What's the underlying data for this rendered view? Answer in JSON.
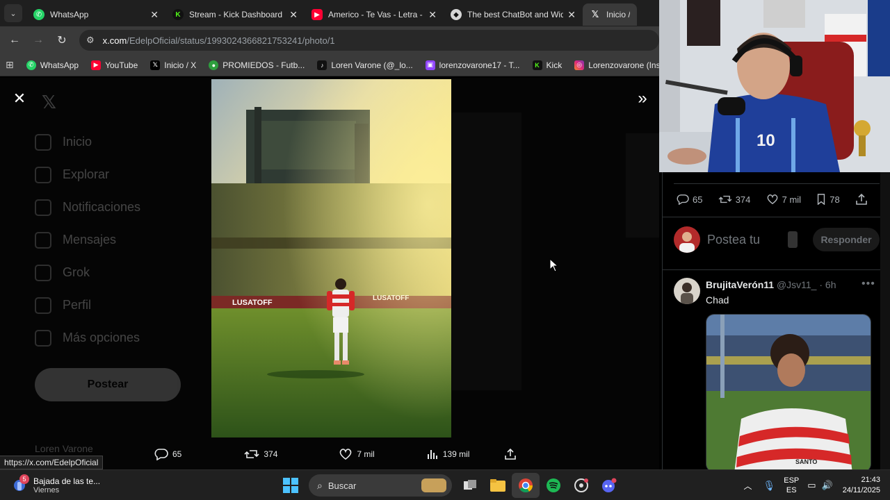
{
  "browser": {
    "tabs": [
      {
        "title": "WhatsApp",
        "icon": "whatsapp-icon",
        "color": "#25d366"
      },
      {
        "title": "Stream - Kick Dashboard",
        "icon": "kick-icon",
        "color": "#53fc18"
      },
      {
        "title": "Americo - Te Vas - Letra - Yo",
        "icon": "youtube-icon",
        "color": "#ff0033"
      },
      {
        "title": "The best ChatBot and Widge",
        "icon": "chatbot-icon",
        "color": "#d6d6d6"
      },
      {
        "title": "Inicio / X",
        "icon": "x-icon",
        "color": "#ffffff"
      }
    ],
    "url_host": "x.com",
    "url_path": "/EdelpOficial/status/1993024366821753241/photo/1",
    "bookmarks": [
      {
        "label": "WhatsApp",
        "color": "#25d366",
        "glyph": "W"
      },
      {
        "label": "YouTube",
        "color": "#ff0033",
        "glyph": "▶"
      },
      {
        "label": "Inicio / X",
        "color": "#000000",
        "glyph": "X"
      },
      {
        "label": "PROMIEDOS - Futb...",
        "color": "#2e9e3e",
        "glyph": "P"
      },
      {
        "label": "Loren Varone (@_lo...",
        "color": "#111111",
        "glyph": "♪"
      },
      {
        "label": "lorenzovarone17 - T...",
        "color": "#9146ff",
        "glyph": "T"
      },
      {
        "label": "Kick",
        "color": "#53fc18",
        "glyph": "K"
      },
      {
        "label": "Lorenzovarone (Inst...",
        "color": "#d6249f",
        "glyph": "◎"
      }
    ]
  },
  "x_underlay": {
    "nav": [
      "Inicio",
      "Explorar",
      "Notificaciones",
      "Mensajes",
      "Grok",
      "Perfil",
      "Más opciones"
    ],
    "post_label": "Postear",
    "user_name": "Loren Varone"
  },
  "photo_actions": {
    "replies": "65",
    "reposts": "374",
    "likes": "7 mil",
    "views": "139 mil"
  },
  "status_link": "https://x.com/EdelpOficial",
  "replies_panel": {
    "stats": {
      "replies": "65",
      "reposts": "374",
      "likes": "7 mil",
      "bookmarks": "78"
    },
    "reply_placeholder": "Postea tu",
    "reply_button": "Responder",
    "tweet": {
      "name": "BrujitaVerón11",
      "handle": "@Jsv11_",
      "time": "· 6h",
      "text": "Chad"
    }
  },
  "taskbar": {
    "news_badge": "5",
    "news_title": "Bajada de las te...",
    "news_sub": "Viernes",
    "search_label": "Buscar",
    "lang_top": "ESP",
    "lang_bottom": "ES",
    "time": "21:43",
    "date": "24/11/2025"
  },
  "colors": {
    "x_bg": "#000000",
    "border": "#2f3336",
    "muted": "#71767b",
    "estudiantes_red": "#d62828"
  }
}
